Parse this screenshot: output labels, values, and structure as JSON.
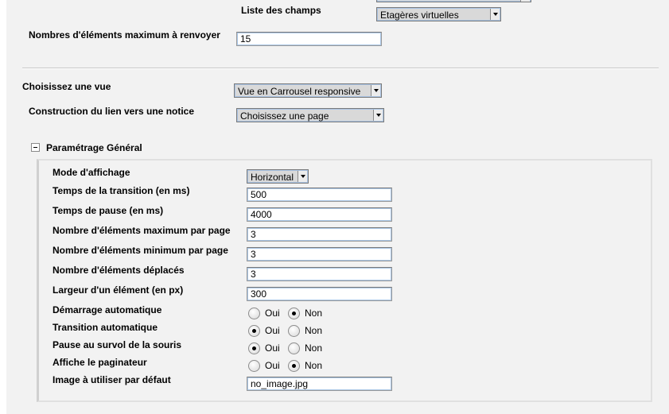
{
  "top": {
    "liste_label": "Liste des champs",
    "liste_value": "Etagères virtuelles",
    "max_label": "Nombres d'éléments maximum à renvoyer",
    "max_value": "15"
  },
  "view": {
    "label": "Choisissez une vue",
    "value": "Vue en Carrousel responsive",
    "link_label": "Construction du lien vers une notice",
    "link_value": "Choisissez une page"
  },
  "general": {
    "title": "Paramétrage Général",
    "mode_label": "Mode d'affichage",
    "mode_value": "Horizontal",
    "fields": [
      {
        "label": "Temps de la transition (en ms)",
        "value": "500"
      },
      {
        "label": "Temps de pause (en ms)",
        "value": "4000"
      },
      {
        "label": "Nombre d'éléments maximum par page",
        "value": "3"
      },
      {
        "label": "Nombre d'éléments minimum par page",
        "value": "3"
      },
      {
        "label": "Nombre d'éléments déplacés",
        "value": "3"
      },
      {
        "label": "Largeur d'un élément (en px)",
        "value": "300"
      }
    ],
    "radios": [
      {
        "label": "Démarrage automatique",
        "selected": "Non"
      },
      {
        "label": "Transition automatique",
        "selected": "Oui"
      },
      {
        "label": "Pause au survol de la souris",
        "selected": "Oui"
      },
      {
        "label": "Affiche le paginateur",
        "selected": "Non"
      }
    ],
    "yes": "Oui",
    "no": "Non",
    "image_label": "Image à utiliser par défaut",
    "image_value": "no_image.jpg"
  }
}
